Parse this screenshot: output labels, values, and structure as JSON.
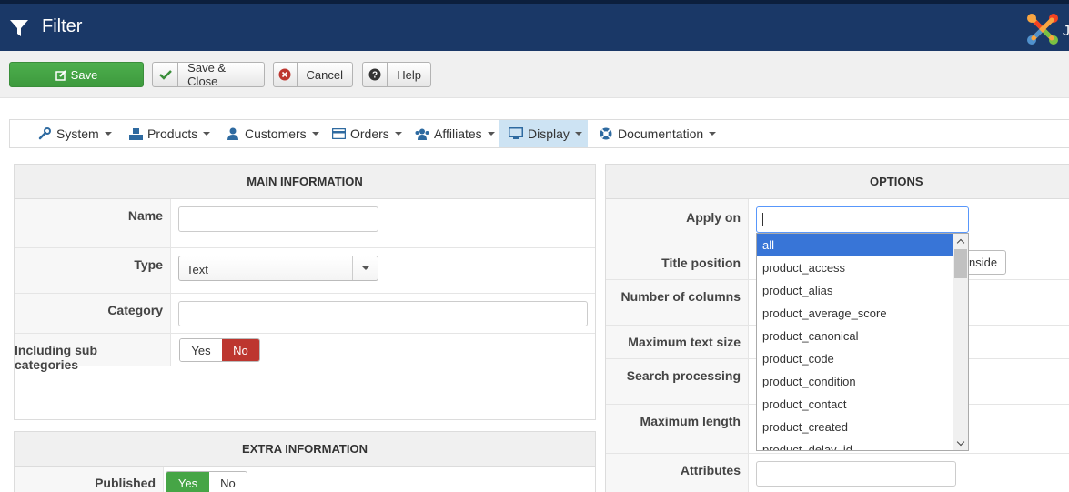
{
  "header": {
    "title": "Filter",
    "logo_tail": "J"
  },
  "toolbar": {
    "save": "Save",
    "save_close": "Save & Close",
    "cancel": "Cancel",
    "help": "Help"
  },
  "nav": {
    "items": [
      {
        "label": "System",
        "icon": "wrench-icon"
      },
      {
        "label": "Products",
        "icon": "cubes-icon"
      },
      {
        "label": "Customers",
        "icon": "user-icon"
      },
      {
        "label": "Orders",
        "icon": "credit-card-icon"
      },
      {
        "label": "Affiliates",
        "icon": "users-icon"
      },
      {
        "label": "Display",
        "icon": "monitor-icon",
        "active": true
      },
      {
        "label": "Documentation",
        "icon": "lifebuoy-icon"
      }
    ]
  },
  "main_info": {
    "heading": "MAIN INFORMATION",
    "name_label": "Name",
    "name_value": "",
    "type_label": "Type",
    "type_value": "Text",
    "category_label": "Category",
    "category_value": "",
    "sub_label": "Including sub categories",
    "sub_yes": "Yes",
    "sub_no": "No",
    "sub_selected": "No"
  },
  "extra_info": {
    "heading": "EXTRA INFORMATION",
    "published_label": "Published",
    "pub_yes": "Yes",
    "pub_no": "No",
    "pub_selected": "Yes"
  },
  "options": {
    "heading": "OPTIONS",
    "apply_on_label": "Apply on",
    "title_position_label": "Title position",
    "title_position_button": "nside",
    "number_columns_label": "Number of columns",
    "max_text_size_label": "Maximum text size",
    "search_processing_label": "Search processing",
    "max_length_label": "Maximum length",
    "attributes_label": "Attributes",
    "attributes_value": ""
  },
  "dropdown": {
    "search_value": "",
    "options": [
      "all",
      "product_access",
      "product_alias",
      "product_average_score",
      "product_canonical",
      "product_code",
      "product_condition",
      "product_contact",
      "product_created",
      "product_delay_id"
    ],
    "selected": "all"
  },
  "colors": {
    "header_bg": "#1a3867",
    "save_green": "#46a546",
    "no_red": "#bd362f",
    "active_nav": "#cde3f3",
    "dropdown_selected": "#3875d7"
  }
}
